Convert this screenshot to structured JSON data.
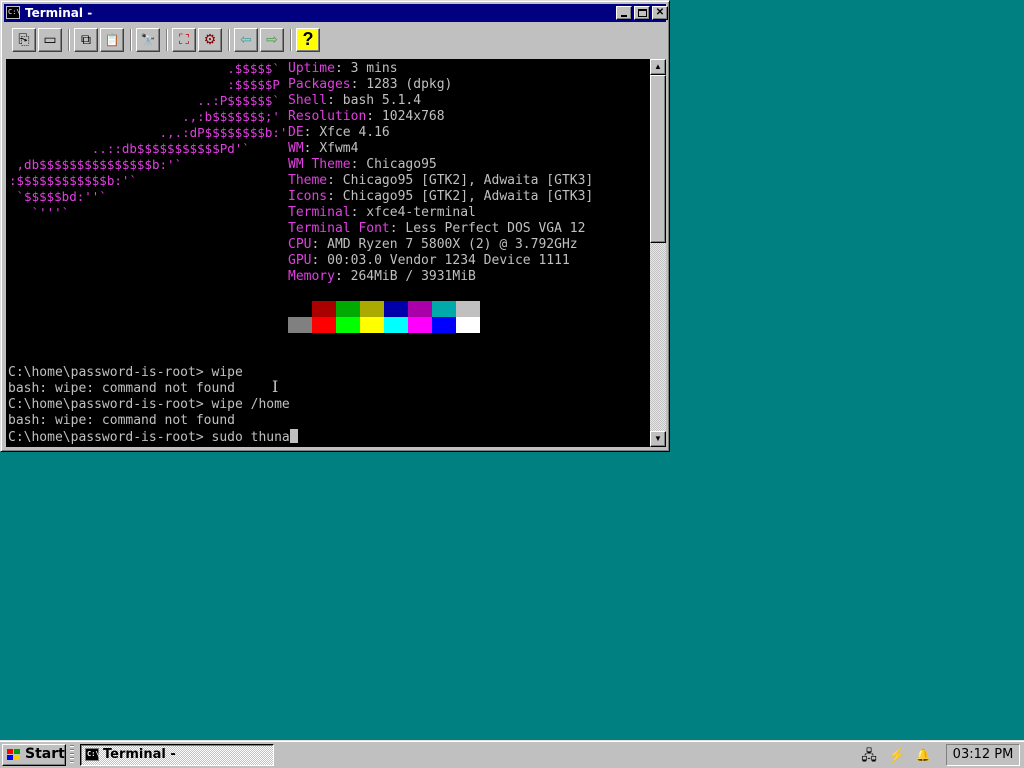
{
  "window": {
    "title": "Terminal -",
    "icon": "C:\\",
    "controls": {
      "minimize": "minimize",
      "maximize": "maximize",
      "close": "✕"
    }
  },
  "toolbar": {
    "buttons": [
      {
        "name": "new-tab-icon",
        "glyph": "⎘"
      },
      {
        "name": "new-window-icon",
        "glyph": "▭"
      },
      {
        "name": "copy-icon",
        "glyph": "⧉"
      },
      {
        "name": "paste-icon",
        "glyph": "📋"
      },
      {
        "name": "find-icon",
        "glyph": "🔭"
      },
      {
        "name": "fullscreen-icon",
        "glyph": "⛶"
      },
      {
        "name": "preferences-icon",
        "glyph": "⚙"
      },
      {
        "name": "back-arrow-icon",
        "glyph": "⇦"
      },
      {
        "name": "forward-arrow-icon",
        "glyph": "⇨"
      },
      {
        "name": "help-icon",
        "glyph": "?"
      }
    ]
  },
  "terminal": {
    "logo": "                             .$$$$$`\n                             :$$$$$P\n                         ..:P$$$$$$`\n                       .,:b$$$$$$$;'\n                    .,.:dP$$$$$$$$b:'\n           ..::db$$$$$$$$$$$Pd'`\n ,db$$$$$$$$$$$$$$$b:'`\n:$$$$$$$$$$$$b:'`\n `$$$$$bd:''`\n   `'''`",
    "info": [
      {
        "key": "Uptime",
        "value": "3 mins"
      },
      {
        "key": "Packages",
        "value": "1283 (dpkg)"
      },
      {
        "key": "Shell",
        "value": "bash 5.1.4"
      },
      {
        "key": "Resolution",
        "value": "1024x768"
      },
      {
        "key": "DE",
        "value": "Xfce 4.16"
      },
      {
        "key": "WM",
        "value": "Xfwm4"
      },
      {
        "key": "WM Theme",
        "value": "Chicago95"
      },
      {
        "key": "Theme",
        "value": "Chicago95 [GTK2], Adwaita [GTK3]"
      },
      {
        "key": "Icons",
        "value": "Chicago95 [GTK2], Adwaita [GTK3]"
      },
      {
        "key": "Terminal",
        "value": "xfce4-terminal"
      },
      {
        "key": "Terminal Font",
        "value": "Less Perfect DOS VGA 12"
      },
      {
        "key": "CPU",
        "value": "AMD Ryzen 7 5800X (2) @ 3.792GHz"
      },
      {
        "key": "GPU",
        "value": "00:03.0 Vendor 1234 Device 1111"
      },
      {
        "key": "Memory",
        "value": "264MiB / 3931MiB"
      }
    ],
    "palette_top": [
      "#000000",
      "#aa0000",
      "#00aa00",
      "#aaaa00",
      "#0000aa",
      "#aa00aa",
      "#00aaaa",
      "#c0c0c0"
    ],
    "palette_bottom": [
      "#808080",
      "#ff0000",
      "#00ff00",
      "#ffff00",
      "#00ffff",
      "#ff00ff",
      "#0000ff",
      "#ffffff"
    ],
    "lines": [
      "C:\\home\\password-is-root> wipe",
      "bash: wipe: command not found",
      "C:\\home\\password-is-root> wipe /home",
      "bash: wipe: command not found",
      "C:\\home\\password-is-root> sudo thuna"
    ],
    "ibeam": "I"
  },
  "scrollbar": {
    "up": "▲",
    "down": "▼"
  },
  "taskbar": {
    "start_label": "Start",
    "task_label": "Terminal -",
    "task_icon": "C:\\",
    "tray": [
      {
        "name": "network-icon",
        "glyph": "🖧"
      },
      {
        "name": "volume-icon",
        "glyph": "⚡"
      },
      {
        "name": "notification-bell-icon",
        "glyph": "🔔"
      }
    ],
    "clock": "03:12 PM"
  }
}
